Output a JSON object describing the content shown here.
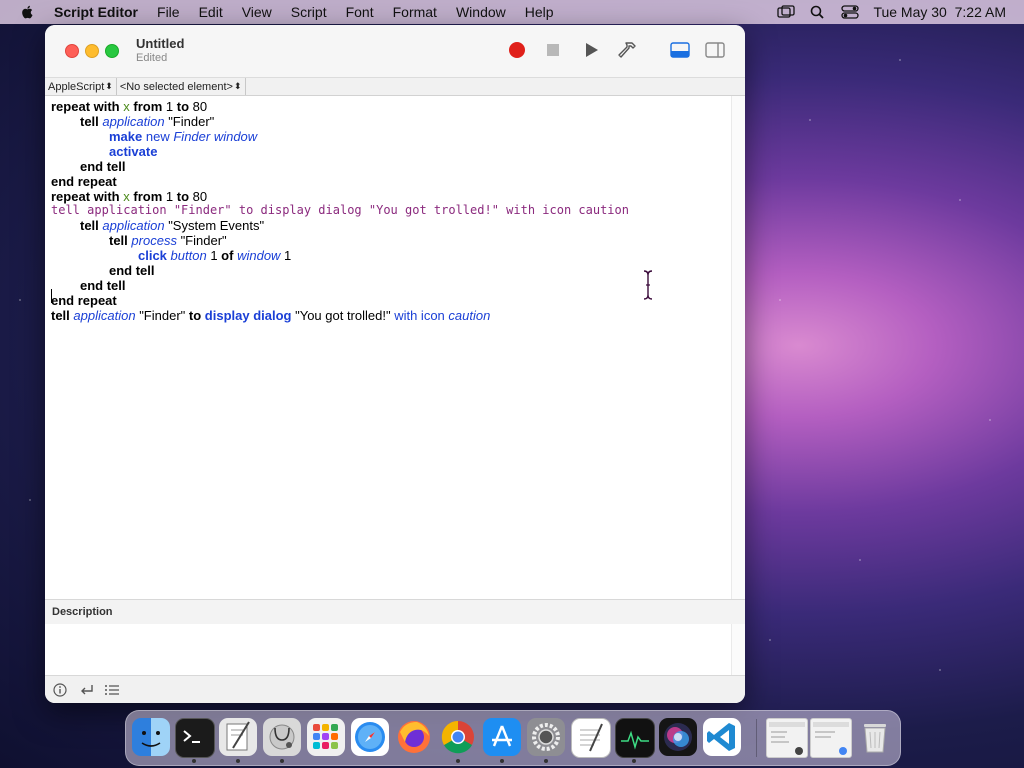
{
  "menubar": {
    "app_name": "Script Editor",
    "menus": [
      "File",
      "Edit",
      "View",
      "Script",
      "Font",
      "Format",
      "Window",
      "Help"
    ],
    "datetime": "Tue May 30  7:22 AM"
  },
  "window": {
    "title": "Untitled",
    "subtitle": "Edited",
    "toolbar": {
      "record_icon": "record-icon",
      "stop_icon": "stop-icon",
      "run_icon": "run-icon",
      "compile_icon": "hammer-icon",
      "show_log_icon": "log-pane-icon",
      "show_library_icon": "sidebar-icon"
    },
    "navbar": {
      "language": "AppleScript",
      "element": "<No selected element>"
    },
    "colors": {
      "record": "#e0201a",
      "keyword_blue": "#1a3fd6",
      "variable_green": "#4b8a1a",
      "raw_text_purple": "#8b2a7e"
    },
    "description_label": "Description"
  },
  "code": {
    "l1": {
      "a": "repeat with",
      "b": "x",
      "c": "from",
      "d": " 1 ",
      "e": "to",
      "f": " 80"
    },
    "l2": {
      "a": "tell",
      "b": "application",
      "c": " \"Finder\""
    },
    "l3": {
      "a": "make",
      "b": "new",
      "c": "Finder window"
    },
    "l4": {
      "a": "activate"
    },
    "l5": {
      "a": "end tell"
    },
    "l6": {
      "a": "end repeat"
    },
    "l7": {
      "a": "repeat with",
      "b": "x",
      "c": "from",
      "d": " 1 ",
      "e": "to",
      "f": " 80"
    },
    "l8": {
      "a": "tell application \"Finder\" to display dialog \"You got trolled!\" with icon caution"
    },
    "l9": {
      "a": "tell",
      "b": "application",
      "c": " \"System Events\""
    },
    "l10": {
      "a": "tell",
      "b": "process",
      "c": " \"Finder\""
    },
    "l11": {
      "a": "click",
      "b": "button",
      "c": " 1 ",
      "d": "of",
      "e": "window",
      "f": " 1"
    },
    "l12": {
      "a": "end tell"
    },
    "l13": {
      "a": "end tell"
    },
    "l14": {
      "a": "end repeat"
    },
    "l15": {
      "a": "tell",
      "b": "application",
      "c": " \"Finder\" ",
      "d": "to",
      "e": "display dialog",
      "f": " \"You got trolled!\" ",
      "g": "with icon",
      "h": "caution"
    }
  },
  "dock": {
    "apps": [
      "finder-icon",
      "terminal-icon",
      "script-editor-icon",
      "disk-utility-icon",
      "launchpad-icon",
      "safari-icon",
      "firefox-icon",
      "chrome-icon",
      "app-store-icon",
      "system-preferences-icon",
      "textedit-icon",
      "activity-monitor-icon",
      "siri-icon",
      "vscode-icon",
      "minimized-window-icon",
      "minimized-window-icon",
      "trash-icon"
    ]
  }
}
